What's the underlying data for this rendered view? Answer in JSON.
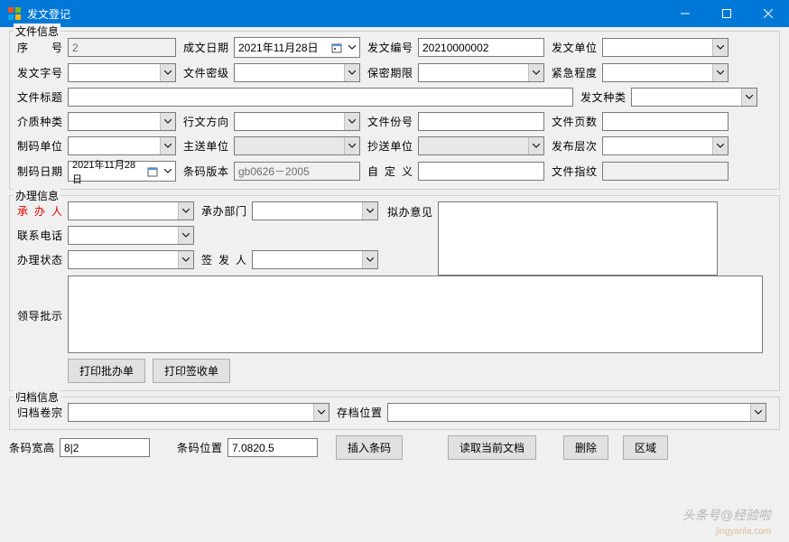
{
  "window": {
    "title": "发文登记"
  },
  "sections": {
    "file_info": "文件信息",
    "handle_info": "办理信息",
    "archive_info": "归档信息"
  },
  "file": {
    "seq_label": "序　　号",
    "seq_value": "2",
    "date_label": "成文日期",
    "date_value": "2021年11月28日",
    "docno_label": "发文编号",
    "docno_value": "20210000002",
    "unit_label": "发文单位",
    "word_label": "发文字号",
    "secret_label": "文件密级",
    "period_label": "保密期限",
    "urgency_label": "紧急程度",
    "title_label": "文件标题",
    "kind_label": "发文种类",
    "media_label": "介质种类",
    "direction_label": "行文方向",
    "copies_label": "文件份号",
    "pages_label": "文件页数",
    "makeunit_label": "制码单位",
    "mainsend_label": "主送单位",
    "copysend_label": "抄送单位",
    "publevel_label": "发布层次",
    "makedate_label": "制码日期",
    "makedate_value": "2021年11月28日",
    "barver_label": "条码版本",
    "barver_value": "gb0626－2005",
    "custom_label": "自定义",
    "fingerprint_label": "文件指纹"
  },
  "handle": {
    "person_label": "承 办 人",
    "dept_label": "承办部门",
    "opinion_label": "拟办意见",
    "phone_label": "联系电话",
    "status_label": "办理状态",
    "signer_label": "签  发  人",
    "leader_label": "领导批示",
    "print_batch_label": "打印批办单",
    "print_sign_label": "打印签收单"
  },
  "archive": {
    "volume_label": "归档卷宗",
    "location_label": "存档位置"
  },
  "bottom": {
    "barwh_label": "条码宽高",
    "barwh_value": "8|2",
    "barpos_label": "条码位置",
    "barpos_value": "7.0820.5",
    "insert_label": "插入条码",
    "read_label": "读取当前文档",
    "delete_label": "删除",
    "region_label": "区域"
  },
  "watermark": {
    "main": "头条号@经验啦",
    "sub": "jingyanla.com"
  }
}
